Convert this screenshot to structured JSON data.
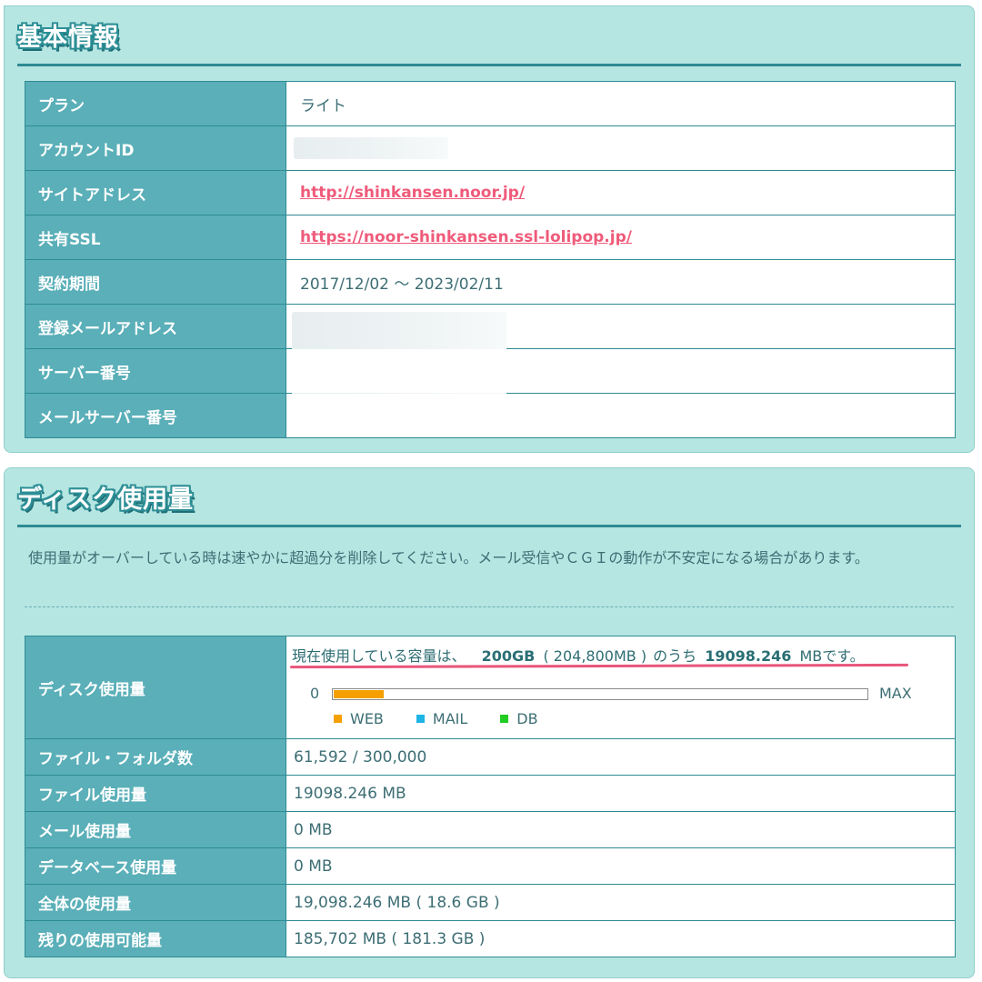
{
  "basic": {
    "title": "基本情報",
    "rows": [
      {
        "label": "プラン",
        "value": "ライト"
      },
      {
        "label": "アカウントID",
        "value": ""
      },
      {
        "label": "サイトアドレス",
        "value": "http://shinkansen.noor.jp/"
      },
      {
        "label": "共有SSL",
        "value": "https://noor-shinkansen.ssl-lolipop.jp/"
      },
      {
        "label": "契約期間",
        "value": "2017/12/02 ～ 2023/02/11"
      },
      {
        "label": "登録メールアドレス",
        "value": ""
      },
      {
        "label": "サーバー番号",
        "value": ""
      },
      {
        "label": "メールサーバー番号",
        "value": ""
      }
    ]
  },
  "disk": {
    "title": "ディスク使用量",
    "notice": "使用量がオーバーしている時は速やかに超過分を削除してください。メール受信やＣＧＩの動作が不安定になる場合があります。",
    "usage": {
      "label": "ディスク使用量",
      "prefix": "現在使用している容量は、",
      "capacity": "200GB",
      "capacity_mb": "( 204,800MB )",
      "middle": "のうち",
      "used": "19098.246",
      "suffix": "MBです。",
      "bar_min": "0",
      "bar_max": "MAX",
      "used_fraction": 0.0932,
      "legend": [
        {
          "label": "WEB",
          "color": "#f5a000"
        },
        {
          "label": "MAIL",
          "color": "#1eb4e6"
        },
        {
          "label": "DB",
          "color": "#22cc22"
        }
      ]
    },
    "rows": [
      {
        "label": "ファイル・フォルダ数",
        "value": "61,592 / 300,000"
      },
      {
        "label": "ファイル使用量",
        "value": "19098.246 MB"
      },
      {
        "label": "メール使用量",
        "value": "0 MB"
      },
      {
        "label": "データベース使用量",
        "value": "0 MB"
      },
      {
        "label": "全体の使用量",
        "value": "19,098.246 MB ( 18.6 GB )"
      },
      {
        "label": "残りの使用可能量",
        "value": "185,702 MB ( 181.3 GB )"
      }
    ]
  }
}
